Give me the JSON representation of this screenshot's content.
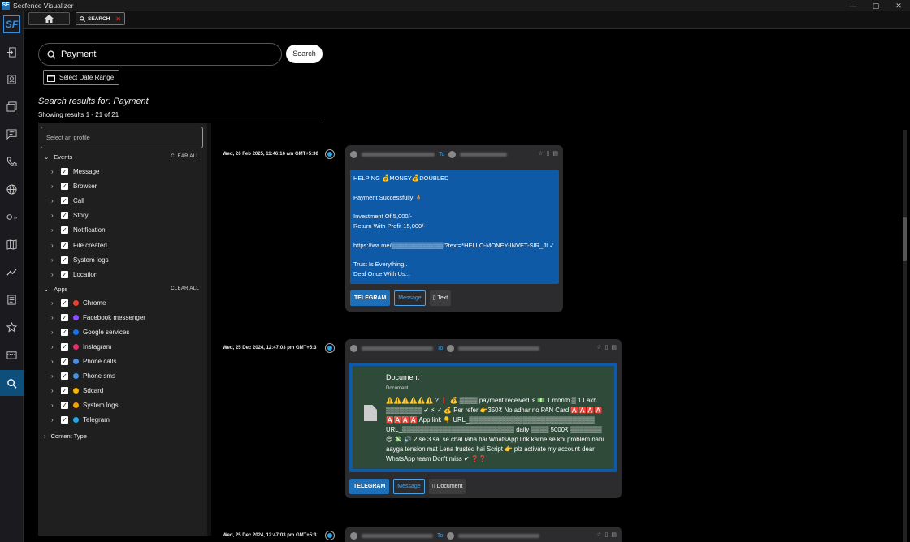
{
  "window": {
    "title": "Secfence Visualizer",
    "logo_text": "SF",
    "controls": [
      "—",
      "▢",
      "✕"
    ]
  },
  "tabs": {
    "search_label": "SEARCH",
    "close_glyph": "✕"
  },
  "search": {
    "value": "Payment",
    "button_label": "Search",
    "date_range_label": "Select Date Range"
  },
  "results": {
    "title": "Search results for: Payment",
    "count": "Showing results 1 - 21 of 21"
  },
  "filters": {
    "profile_placeholder": "Select an profile",
    "clear_all_label": "CLEAR ALL",
    "events_label": "Events",
    "events": [
      "Message",
      "Browser",
      "Call",
      "Story",
      "Notification",
      "File created",
      "System logs",
      "Location"
    ],
    "apps_label": "Apps",
    "apps": [
      {
        "label": "Chrome",
        "color": "#e94335"
      },
      {
        "label": "Facebook messenger",
        "color": "#8a4dff"
      },
      {
        "label": "Google services",
        "color": "#1a73e8"
      },
      {
        "label": "Instagram",
        "color": "#e1306c"
      },
      {
        "label": "Phone calls",
        "color": "#4a90e2"
      },
      {
        "label": "Phone sms",
        "color": "#4a90e2"
      },
      {
        "label": "Sdcard",
        "color": "#f5b400"
      },
      {
        "label": "System logs",
        "color": "#f5a000"
      },
      {
        "label": "Telegram",
        "color": "#27a7e7"
      }
    ],
    "content_type_label": "Content Type"
  },
  "entries": [
    {
      "timestamp": "Wed, 26 Feb 2025, 11:46:16 am GMT+5:30",
      "to_label": "To",
      "body": "HELPING 💰MONEY💰DOUBLED\n\nPayment Successfully 🧍\n\nInvestment Of 5,000/-\nReturn With Profit 15,000/-\n\nhttps://wa.me/▒▒▒▒▒▒▒▒▒▒▒▒/?text=*HELLO-MONEY-INVET-SIR_JI ✓\n\nTrust Is Everything..\nDeal Once With Us...",
      "source": "TELEGRAM",
      "category": "Message",
      "type": "Text"
    },
    {
      "timestamp": "Wed, 25 Dec 2024, 12:47:03 pm GMT+5:3",
      "to_label": "To",
      "doc_title": "Document",
      "doc_subtitle": "Document",
      "body": "⚠️⚠️⚠️⚠️⚠️⚠️ ? ❗ 💰 ▒▒▒▒ payment received ⚡ 💵 1 month ▒ 1 Lakh ▒▒▒▒▒▒▒▒ ✔ ⚡ ✓ 💰 Per refer 👉350₹ No adhar no PAN Card 🅰️🅰️🅰️🅰️ 🅰️🅰️🅰️🅰️ App link 👇 URL_▒▒▒▒▒▒▒▒▒▒▒▒▒▒▒▒▒▒▒▒▒▒▒▒▒▒▒▒ URL_▒▒▒▒▒▒▒▒▒▒▒▒▒▒▒▒▒▒▒▒▒▒▒▒▒ daily ▒▒▒▒ 5000₹ ▒▒▒▒▒▒▒ 😍 💸 🔊 2 se 3 sal se chal raha hai WhatsApp link karne se koi problem nahi aayga tension mat Lena trusted hai Script 👉 plz activate my account dear WhatsApp team Don't miss ✔ ❓❓",
      "source": "TELEGRAM",
      "category": "Message",
      "type": "Document"
    },
    {
      "timestamp": "Wed, 25 Dec 2024, 12:47:03 pm GMT+5:3",
      "to_label": "To"
    }
  ]
}
